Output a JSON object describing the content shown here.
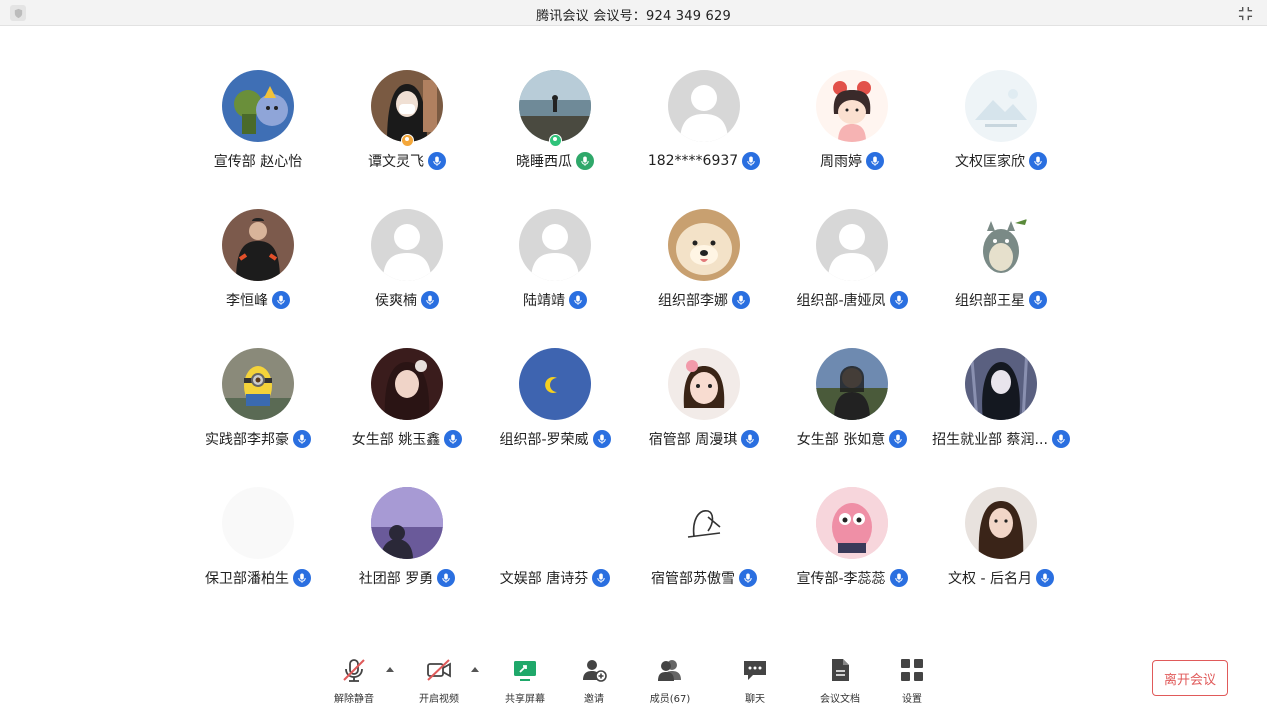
{
  "window": {
    "title": "腾讯会议 会议号：924 349 629"
  },
  "participants": [
    {
      "name": "宣传部 赵心怡",
      "mic": false,
      "badge": "",
      "avatar": "cartoon-blue"
    },
    {
      "name": "谭文灵飞",
      "mic": true,
      "badge": "orange",
      "avatar": "photo-girl-mask"
    },
    {
      "name": "晓睡西瓜",
      "mic": true,
      "badge": "green",
      "avatar": "photo-beach"
    },
    {
      "name": "182****6937",
      "mic": true,
      "badge": "",
      "avatar": "default"
    },
    {
      "name": "周雨婷",
      "mic": true,
      "badge": "",
      "avatar": "cartoon-girl"
    },
    {
      "name": "文权匡家欣",
      "mic": true,
      "badge": "",
      "avatar": "placeholder-image"
    },
    {
      "name": "李恒峰",
      "mic": true,
      "badge": "",
      "avatar": "photo-jacket"
    },
    {
      "name": "侯爽楠",
      "mic": true,
      "badge": "",
      "avatar": "default"
    },
    {
      "name": "陆靖靖",
      "mic": true,
      "badge": "",
      "avatar": "default"
    },
    {
      "name": "组织部李娜",
      "mic": true,
      "badge": "",
      "avatar": "photo-dog"
    },
    {
      "name": "组织部-唐娅凤",
      "mic": true,
      "badge": "",
      "avatar": "default"
    },
    {
      "name": "组织部王星",
      "mic": true,
      "badge": "",
      "avatar": "cartoon-totoro"
    },
    {
      "name": "实践部李邦豪",
      "mic": true,
      "badge": "",
      "avatar": "cartoon-minion"
    },
    {
      "name": "女生部 姚玉鑫",
      "mic": true,
      "badge": "",
      "avatar": "photo-dark-girl"
    },
    {
      "name": "组织部-罗荣威",
      "mic": true,
      "badge": "",
      "avatar": "blue-moon"
    },
    {
      "name": "宿管部 周漫琪",
      "mic": true,
      "badge": "",
      "avatar": "photo-child"
    },
    {
      "name": "女生部 张如意",
      "mic": true,
      "badge": "",
      "avatar": "photo-street-girl"
    },
    {
      "name": "招生就业部 蔡润...",
      "mic": true,
      "badge": "",
      "avatar": "photo-anime-dark"
    },
    {
      "name": "保卫部潘柏生",
      "mic": true,
      "badge": "",
      "avatar": "white"
    },
    {
      "name": "社团部 罗勇",
      "mic": true,
      "badge": "",
      "avatar": "photo-dusk"
    },
    {
      "name": "文娱部 唐诗芬",
      "mic": true,
      "badge": "",
      "avatar": "none"
    },
    {
      "name": "宿管部苏傲雪",
      "mic": true,
      "badge": "",
      "avatar": "line-sketch"
    },
    {
      "name": "宣传部-李蕊蕊",
      "mic": true,
      "badge": "",
      "avatar": "cartoon-pink"
    },
    {
      "name": "文权 - 后名月",
      "mic": true,
      "badge": "",
      "avatar": "photo-portrait"
    }
  ],
  "toolbar": {
    "unmute": "解除静音",
    "start_video": "开启视频",
    "share_screen": "共享屏幕",
    "invite": "邀请",
    "members": "成员(67)",
    "chat": "聊天",
    "docs": "会议文档",
    "settings": "设置",
    "leave": "离开会议"
  },
  "colors": {
    "accent": "#2a6fe0",
    "share_green": "#1fa86a",
    "leave_red": "#e05a5a"
  }
}
